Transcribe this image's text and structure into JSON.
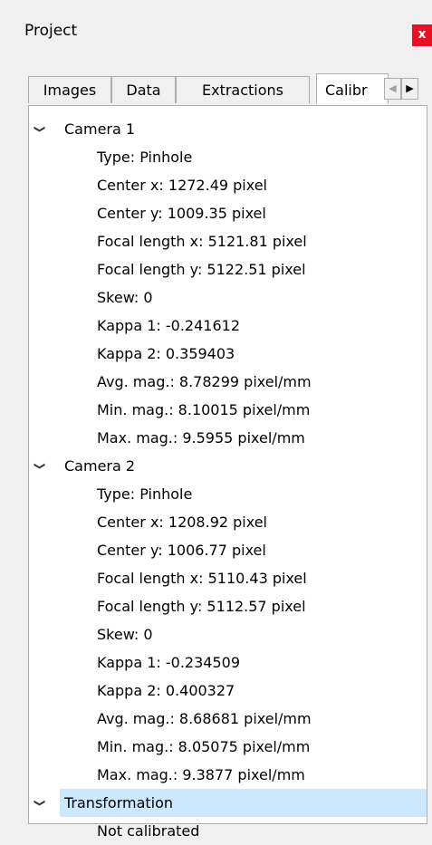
{
  "window": {
    "title": "Project",
    "close_label": "x"
  },
  "tabs": [
    {
      "label": "Images"
    },
    {
      "label": "Data"
    },
    {
      "label": "Extractions"
    },
    {
      "label": "Calibr"
    }
  ],
  "tab_scroll": {
    "left_icon": "◀",
    "right_icon": "▶"
  },
  "tree": {
    "camera1": {
      "label": "Camera 1",
      "items": [
        "Type: Pinhole",
        "Center x: 1272.49 pixel",
        "Center y: 1009.35 pixel",
        "Focal length x: 5121.81 pixel",
        "Focal length y: 5122.51 pixel",
        "Skew: 0",
        "Kappa 1: -0.241612",
        "Kappa 2: 0.359403",
        "Avg. mag.: 8.78299 pixel/mm",
        "Min. mag.: 8.10015 pixel/mm",
        "Max. mag.: 9.5955 pixel/mm"
      ]
    },
    "camera2": {
      "label": "Camera 2",
      "items": [
        "Type: Pinhole",
        "Center x: 1208.92 pixel",
        "Center y: 1006.77 pixel",
        "Focal length x: 5110.43 pixel",
        "Focal length y: 5112.57 pixel",
        "Skew: 0",
        "Kappa 1: -0.234509",
        "Kappa 2: 0.400327",
        "Avg. mag.: 8.68681 pixel/mm",
        "Min. mag.: 8.05075 pixel/mm",
        "Max. mag.: 9.3877 pixel/mm"
      ]
    },
    "transformation": {
      "label": "Transformation",
      "items": [
        "Not calibrated"
      ]
    },
    "expander_icon": "❯"
  },
  "colors": {
    "selection": "#cce8ff",
    "close_button": "#e81123",
    "panel_bg": "#f0f0f0"
  }
}
